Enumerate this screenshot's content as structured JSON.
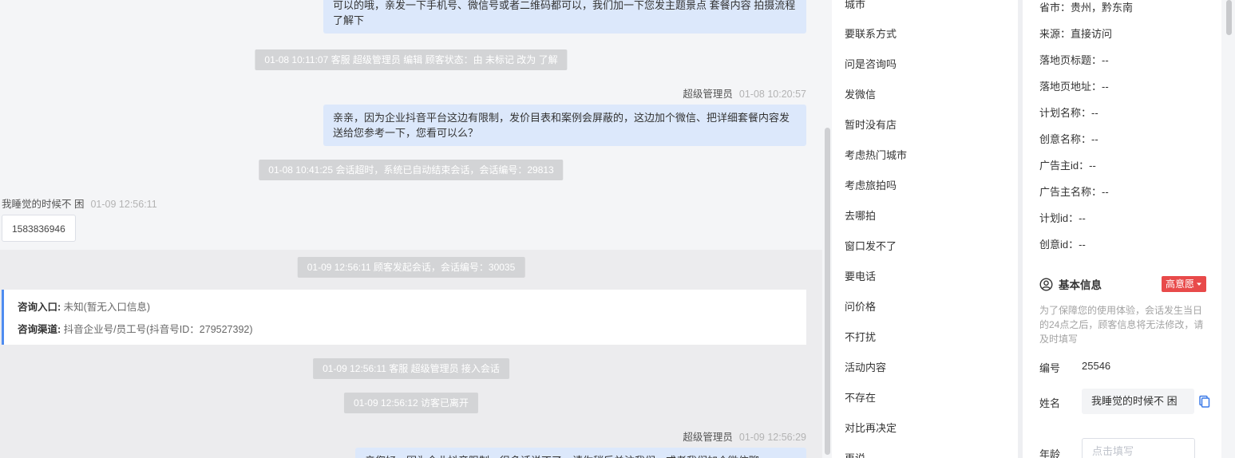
{
  "chat": {
    "messages": {
      "m1_text": "可以的哦，亲发一下手机号、微信号或者二维码都可以，我们加一下您发主题景点 套餐内容 拍摄流程了解下",
      "sys1": "01-08 10:11:07 客服 超级管理员 编辑 顾客状态：由 未标记 改为 了解",
      "m2_sender": "超级管理员",
      "m2_time": "01-08 10:20:57",
      "m2_text": "亲亲，因为企业抖音平台这边有限制，发价目表和案例会屏蔽的，这边加个微信、把详细套餐内容发送给您参考一下，您看可以么？",
      "sys2": "01-08 10:41:25 会话超时，系统已自动结束会话，会话编号：29813",
      "m3_sender": "我睡觉的时候不 困",
      "m3_time": "01-09 12:56:11",
      "m3_text": "1583836946",
      "sys3": "01-09 12:56:11 顾客发起会话，会话编号：30035",
      "entry_label": "咨询入口:",
      "entry_value": "未知(暂无入口信息)",
      "channel_label": "咨询渠道:",
      "channel_value": "抖音企业号/员工号(抖音号ID：279527392)",
      "sys4": "01-09 12:56:11 客服 超级管理员 接入会话",
      "sys5": "01-09 12:56:12 访客已离开",
      "m4_sender": "超级管理员",
      "m4_time": "01-09 12:56:29",
      "m4_text": "亲您好，因为企业抖音限制，很多话说不了，请你稍后关注我们，或者我们加个微信聊"
    }
  },
  "quick_replies": [
    "城市",
    "要联系方式",
    "问是咨询吗",
    "发微信",
    "暂时没有店",
    "考虑热门城市",
    "考虑旅拍吗",
    "去哪拍",
    "窗口发不了",
    "要电话",
    "问价格",
    "不打扰",
    "活动内容",
    "不存在",
    "对比再决定",
    "再说"
  ],
  "customer": {
    "region": "省市：贵州，黔东南",
    "source": "来源：直接访问",
    "landing_title": "落地页标题：--",
    "landing_url": "落地页地址：--",
    "plan_name": "计划名称：--",
    "creative_name": "创意名称：--",
    "advertiser_id": "广告主id：--",
    "advertiser_name": "广告主名称：--",
    "plan_id": "计划id：--",
    "creative_id": "创意id：--",
    "basic_title": "基本信息",
    "intent": "高意愿",
    "notice": "为了保障您的使用体验，会话发生当日的24点之后，顾客信息将无法修改，请及时填写",
    "id_label": "编号",
    "id_value": "25546",
    "name_label": "姓名",
    "name_value": "我睡觉的时候不 困",
    "age_label": "年龄",
    "age_placeholder": "点击填写"
  },
  "colors": {
    "accent": "#4e8cf0",
    "bubble": "#dce8fb",
    "system": "#d3d4d6",
    "intent": "#e84a4a"
  },
  "icons": {
    "basic_info": "user-circle-icon",
    "copy": "copy-icon",
    "dropdown": "caret-down-icon"
  }
}
